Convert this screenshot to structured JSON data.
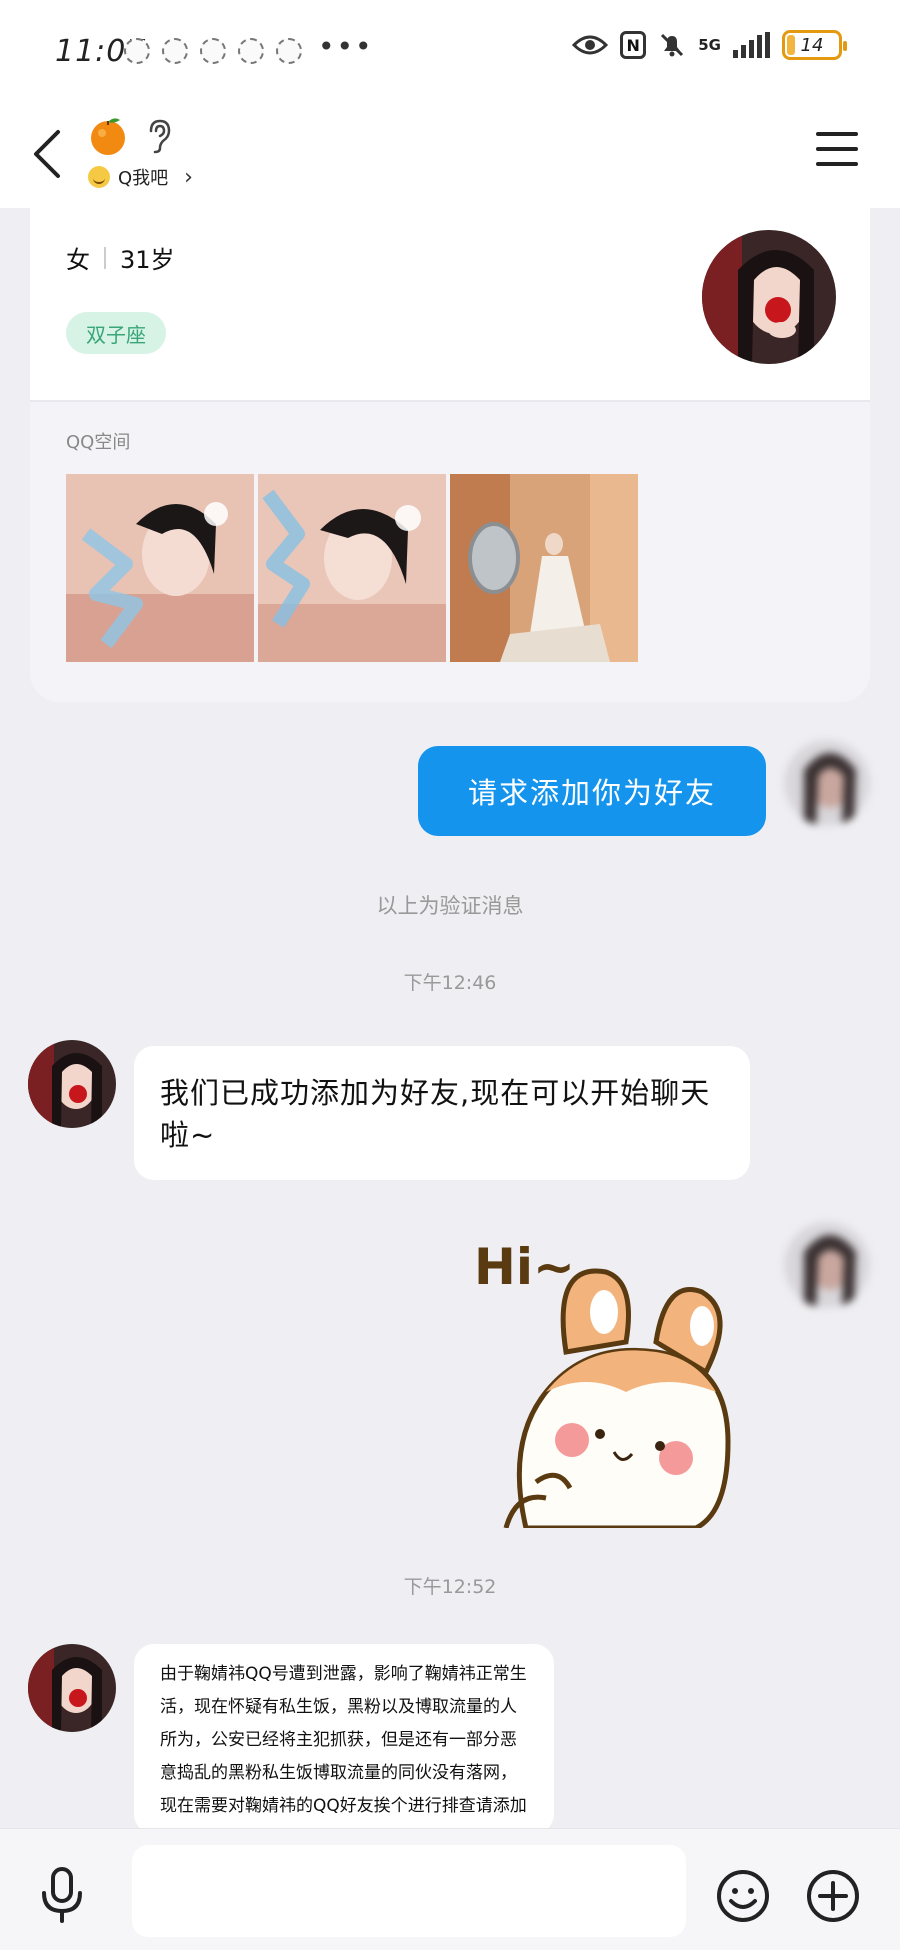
{
  "status_bar": {
    "time": "11:07",
    "more": "•••",
    "nfc": "N",
    "network": "5G",
    "battery": "14",
    "battery_level": 0.14
  },
  "header": {
    "subtitle": "Q我吧",
    "icons": [
      "back-icon",
      "orange-avatar-icon",
      "ear-icon",
      "smile-icon",
      "chevron-right-icon",
      "menu-icon"
    ]
  },
  "profile": {
    "gender": "女",
    "age": "31岁",
    "zodiac": "双子座",
    "space_label": "QQ空间"
  },
  "messages": {
    "friend_request": "请求添加你为好友",
    "verify_note": "以上为验证消息",
    "time_1": "下午12:46",
    "added_text": "我们已成功添加为好友,现在可以开始聊天啦~",
    "sticker_text": "Hi~",
    "time_2": "下午12:52",
    "long_text": "由于鞠婧祎QQ号遭到泄露，影响了鞠婧祎正常生活，现在怀疑有私生饭，黑粉以及博取流量的人所为，公安已经将主犯抓获，但是还有一部分恶意捣乱的黑粉私生饭博取流量的同伙没有落网，现在需要对鞠婧祎的QQ好友挨个进行排查请添加律师QQ进行处理，添加之后登记一下就"
  },
  "input_bar": {
    "placeholder": "",
    "icons": [
      "microphone-icon",
      "emoji-icon",
      "plus-icon"
    ]
  },
  "colors": {
    "accent_blue": "#1594ee",
    "zodiac_bg": "#d6f3e6",
    "zodiac_text": "#3aa577",
    "background": "#efeff3",
    "battery": "#e39a10"
  }
}
